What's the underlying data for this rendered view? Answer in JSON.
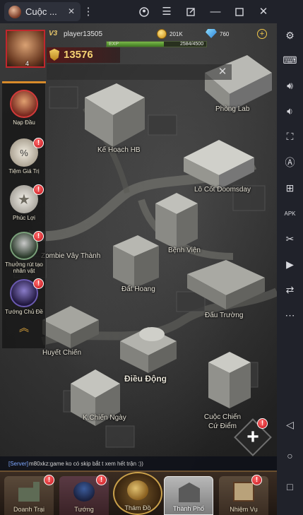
{
  "window": {
    "tab_title": "Cuộc ...",
    "buttons": [
      "account-icon",
      "menu-icon",
      "popout-icon",
      "minimize-icon",
      "maximize-icon",
      "close-icon",
      "collapse-sidebar-icon"
    ]
  },
  "hud": {
    "vip": "V3",
    "player_name": "player13505",
    "gold": "201K",
    "gems": "760",
    "exp_label": "EXP",
    "exp_value": "2584/4500",
    "exp_progress": 0.574,
    "power": "13576",
    "avatar_level": "4"
  },
  "events": [
    {
      "label": "Nạp Đầu",
      "icon": "first-recharge-icon",
      "alert": false
    },
    {
      "label": "Tiệm Giá Trị",
      "icon": "discount-tag-icon",
      "alert": true
    },
    {
      "label": "Phúc Lợi",
      "icon": "welfare-star-icon",
      "alert": true
    },
    {
      "label": "Thưởng rút tạo nhân vật",
      "icon": "character-draw-icon",
      "alert": true
    },
    {
      "label": "Tướng Chủ Đề",
      "icon": "themed-general-icon",
      "alert": true
    }
  ],
  "places": [
    {
      "label": "Phòng Lab"
    },
    {
      "label": "Kế Hoạch HB"
    },
    {
      "label": "Lô Cốt Doomsday"
    },
    {
      "label": "Zombie Vây Thành"
    },
    {
      "label": "Bệnh Viện"
    },
    {
      "label": "Đất Hoang"
    },
    {
      "label": "Đấu Trường"
    },
    {
      "label": "Huyết Chiến"
    },
    {
      "label": "Điều Động"
    },
    {
      "label": "K.Chiến Ngày"
    },
    {
      "label": "Cuộc Chiến Cứ Điểm"
    }
  ],
  "chat": {
    "tag": "[Server]",
    "message": "m80xkz:game ko có skip bắt t xem hết trận :))"
  },
  "nav": [
    {
      "label": "Doanh Trại",
      "alert": true
    },
    {
      "label": "Tướng",
      "alert": true
    },
    {
      "label": "Thám Đồ",
      "alert": false
    },
    {
      "label": "Thành Phố",
      "alert": false
    },
    {
      "label": "Nhiệm Vụ",
      "alert": true
    }
  ],
  "emulator_sidebar": [
    "settings-gear-icon",
    "keyboard-icon",
    "volume-up-icon",
    "volume-down-icon",
    "fullscreen-icon",
    "auto-rotate-icon",
    "screenshot-icon",
    "install-apk-icon",
    "scissors-icon",
    "video-record-icon",
    "sync-icon",
    "more-icon",
    "back-icon",
    "home-icon",
    "recents-icon"
  ],
  "colors": {
    "accent_gold": "#f3c94a",
    "alert_red": "#d8141c",
    "power_gold": "#f4d272"
  }
}
